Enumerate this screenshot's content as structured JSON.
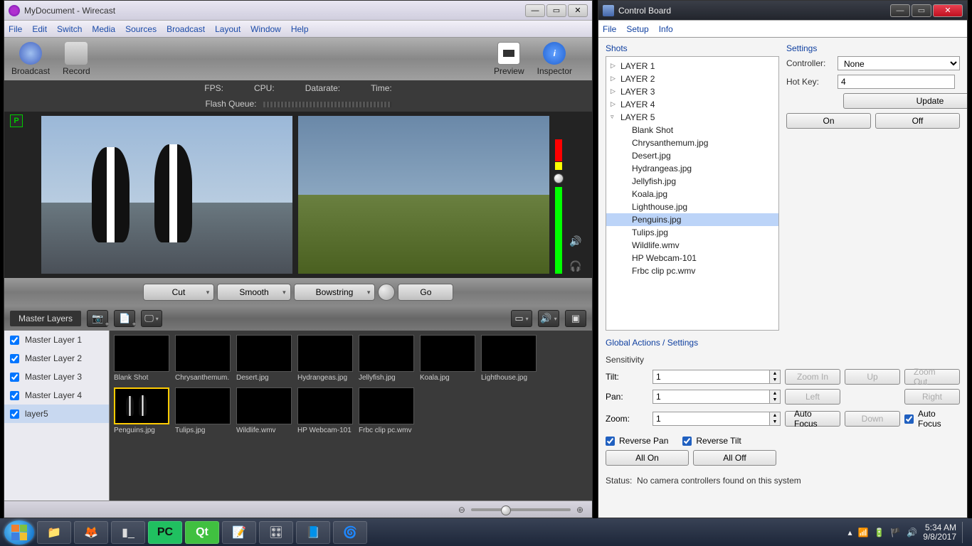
{
  "wirecast": {
    "title": "MyDocument - Wirecast",
    "menu": [
      "File",
      "Edit",
      "Switch",
      "Media",
      "Sources",
      "Broadcast",
      "Layout",
      "Window",
      "Help"
    ],
    "toolbar": {
      "broadcast": "Broadcast",
      "record": "Record",
      "preview": "Preview",
      "inspector": "Inspector"
    },
    "stats": {
      "fps": "FPS:",
      "cpu": "CPU:",
      "datarate": "Datarate:",
      "time": "Time:",
      "flash": "Flash Queue:"
    },
    "controls": {
      "cut": "Cut",
      "smooth": "Smooth",
      "bowstring": "Bowstring",
      "go": "Go"
    },
    "masterLayersLabel": "Master Layers",
    "layers": [
      {
        "label": "Master Layer 1",
        "checked": true
      },
      {
        "label": "Master Layer 2",
        "checked": true
      },
      {
        "label": "Master Layer 3",
        "checked": true
      },
      {
        "label": "Master Layer 4",
        "checked": true
      },
      {
        "label": "layer5",
        "checked": true,
        "selected": true
      }
    ],
    "shots": [
      {
        "label": "Blank Shot",
        "cls": "blank"
      },
      {
        "label": "Chrysanthemum.",
        "cls": "chrys"
      },
      {
        "label": "Desert.jpg",
        "cls": "desert"
      },
      {
        "label": "Hydrangeas.jpg",
        "cls": "hydra"
      },
      {
        "label": "Jellyfish.jpg",
        "cls": "jelly"
      },
      {
        "label": "Koala.jpg",
        "cls": "koala"
      },
      {
        "label": "Lighthouse.jpg",
        "cls": "light"
      },
      {
        "label": "Penguins.jpg",
        "cls": "penguins",
        "selected": true
      },
      {
        "label": "Tulips.jpg",
        "cls": "tulips"
      },
      {
        "label": "Wildlife.wmv",
        "cls": ""
      },
      {
        "label": "HP Webcam-101",
        "cls": ""
      },
      {
        "label": "Frbc clip pc.wmv",
        "cls": ""
      }
    ]
  },
  "cboard": {
    "title": "Control Board",
    "menu": [
      "File",
      "Setup",
      "Info"
    ],
    "shotsLabel": "Shots",
    "settingsLabel": "Settings",
    "layers": [
      "LAYER 1",
      "LAYER 2",
      "LAYER 3",
      "LAYER 4"
    ],
    "layer5": "LAYER 5",
    "layer5items": [
      "Blank Shot",
      "Chrysanthemum.jpg",
      "Desert.jpg",
      "Hydrangeas.jpg",
      "Jellyfish.jpg",
      "Koala.jpg",
      "Lighthouse.jpg",
      "Penguins.jpg",
      "Tulips.jpg",
      "Wildlife.wmv",
      "HP Webcam-101",
      "Frbc clip pc.wmv"
    ],
    "selectedShot": "Penguins.jpg",
    "controllerLabel": "Controller:",
    "controllerValue": "None",
    "hotkeyLabel": "Hot Key:",
    "hotkeyValue": "4",
    "update": "Update",
    "on": "On",
    "off": "Off",
    "globalLabel": "Global Actions / Settings",
    "sensitivity": "Sensitivity",
    "tilt": "Tilt:",
    "pan": "Pan:",
    "zoom": "Zoom:",
    "tiltVal": "1",
    "panVal": "1",
    "zoomVal": "1",
    "zoomIn": "Zoom In",
    "zoomOut": "Zoom Out",
    "up": "Up",
    "down": "Down",
    "left": "Left",
    "right": "Right",
    "autoFocus": "Auto Focus",
    "reversePan": "Reverse Pan",
    "reverseTilt": "Reverse Tilt",
    "allOn": "All On",
    "allOff": "All Off",
    "statusLabel": "Status:",
    "statusText": "No camera controllers found on this system"
  },
  "taskbar": {
    "time": "5:34 AM",
    "date": "9/8/2017"
  }
}
